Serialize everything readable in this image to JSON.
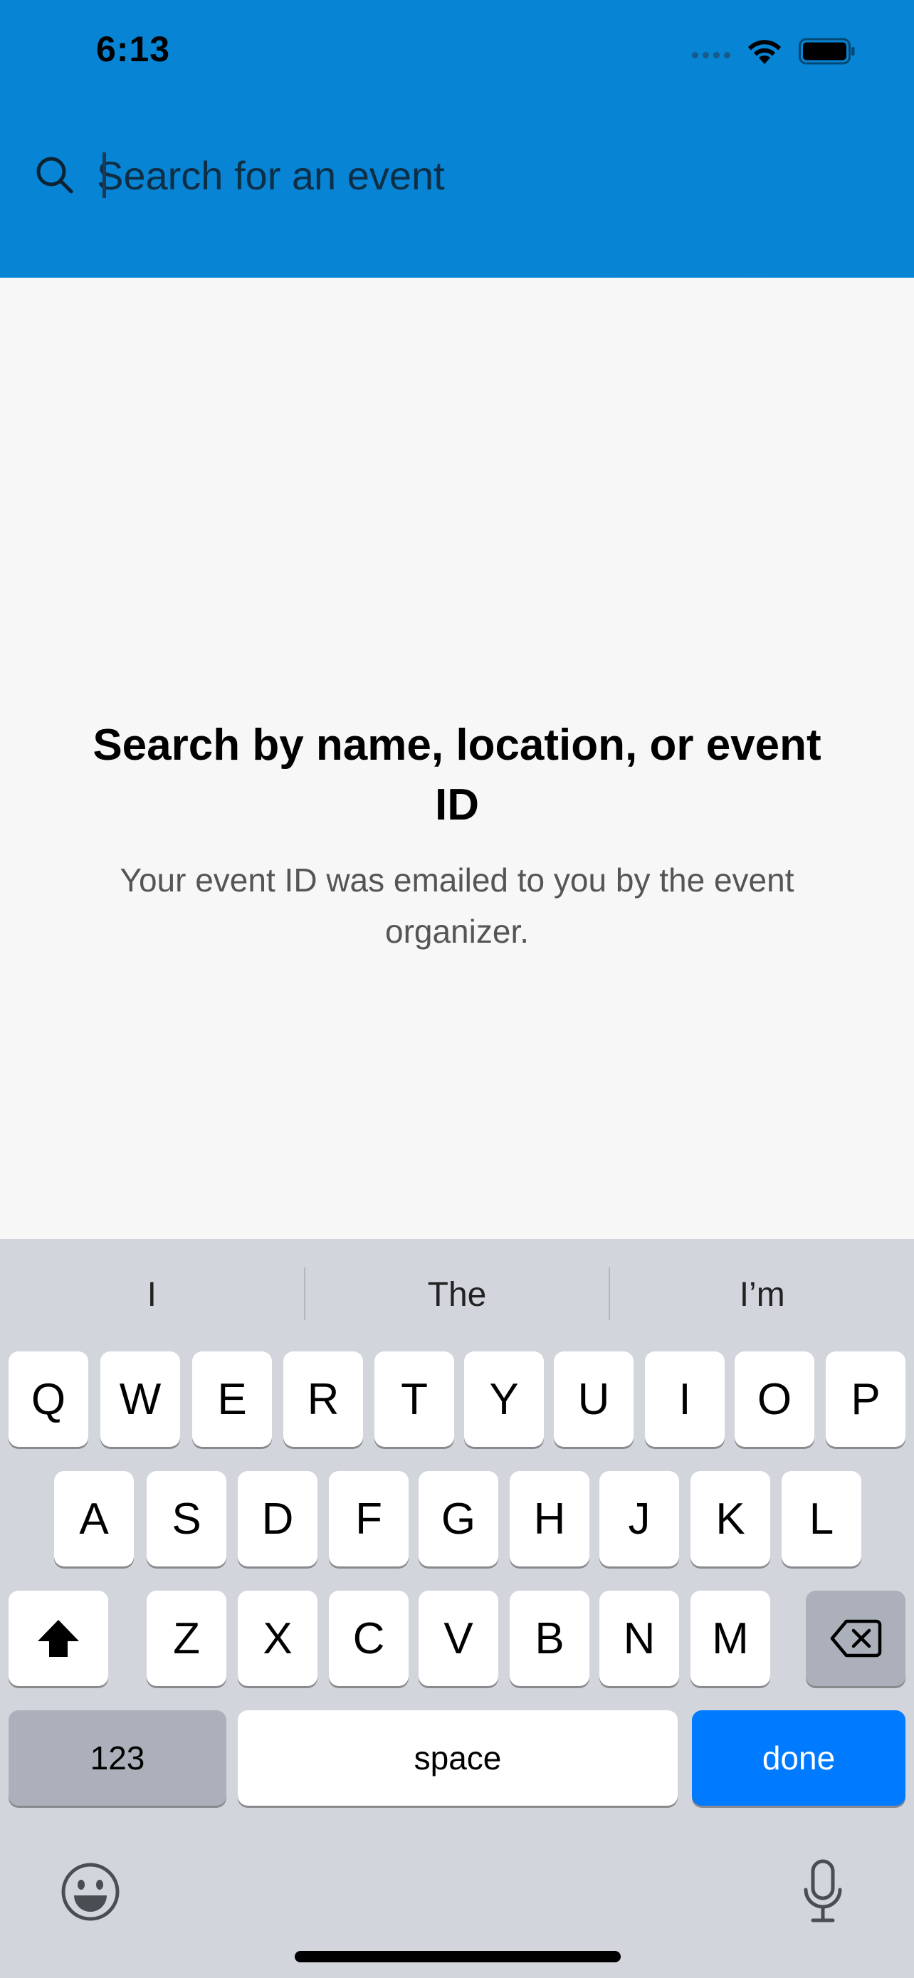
{
  "status_bar": {
    "time": "6:13"
  },
  "search": {
    "placeholder": "Search for an event",
    "value": ""
  },
  "empty_state": {
    "title": "Search by name, location, or event ID",
    "subtitle": "Your event ID was emailed to you by the event organizer."
  },
  "keyboard": {
    "suggestions": [
      "I",
      "The",
      "I’m"
    ],
    "row1": [
      "Q",
      "W",
      "E",
      "R",
      "T",
      "Y",
      "U",
      "I",
      "O",
      "P"
    ],
    "row2": [
      "A",
      "S",
      "D",
      "F",
      "G",
      "H",
      "J",
      "K",
      "L"
    ],
    "row3": [
      "Z",
      "X",
      "C",
      "V",
      "B",
      "N",
      "M"
    ],
    "numbers_label": "123",
    "space_label": "space",
    "done_label": "done"
  },
  "colors": {
    "header": "#0784d4",
    "done": "#007aff",
    "background": "#f7f7f7",
    "keyboard": "#d2d5db"
  }
}
